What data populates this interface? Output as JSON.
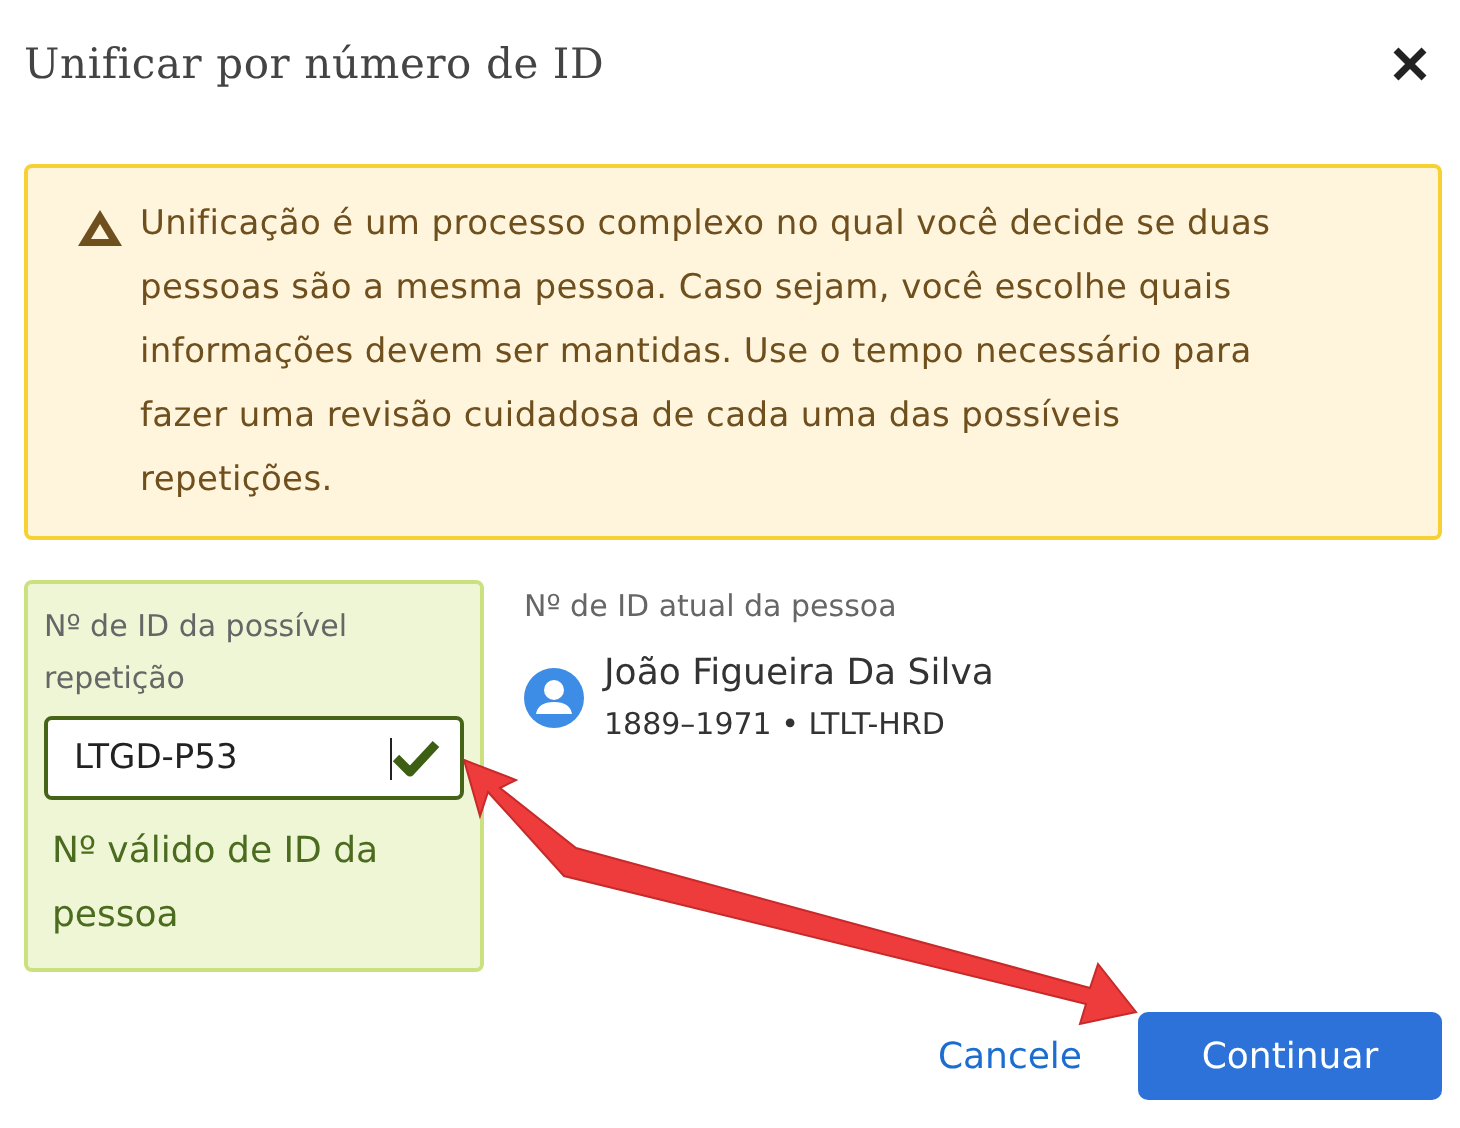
{
  "dialog": {
    "title": "Unificar por número de ID"
  },
  "warning": {
    "text": "Unificação é um processo complexo no qual você decide se duas pessoas são a mesma pessoa. Caso sejam, você escolhe quais informações devem ser mantidas. Use o tempo necessário para fazer uma revisão cuidadosa de cada uma das possíveis repetições."
  },
  "id_field": {
    "label": "Nº de ID da possível repetição",
    "value": "LTGD-P53",
    "valid": true,
    "message": "Nº válido de ID da pessoa"
  },
  "current_person": {
    "label": "Nº de ID atual da pessoa",
    "name": "João Figueira Da Silva",
    "details": "1889–1971 • LTLT-HRD"
  },
  "buttons": [
    {
      "label": "Cancele",
      "kind": "link"
    },
    {
      "label": "Continuar",
      "kind": "primary"
    }
  ]
}
